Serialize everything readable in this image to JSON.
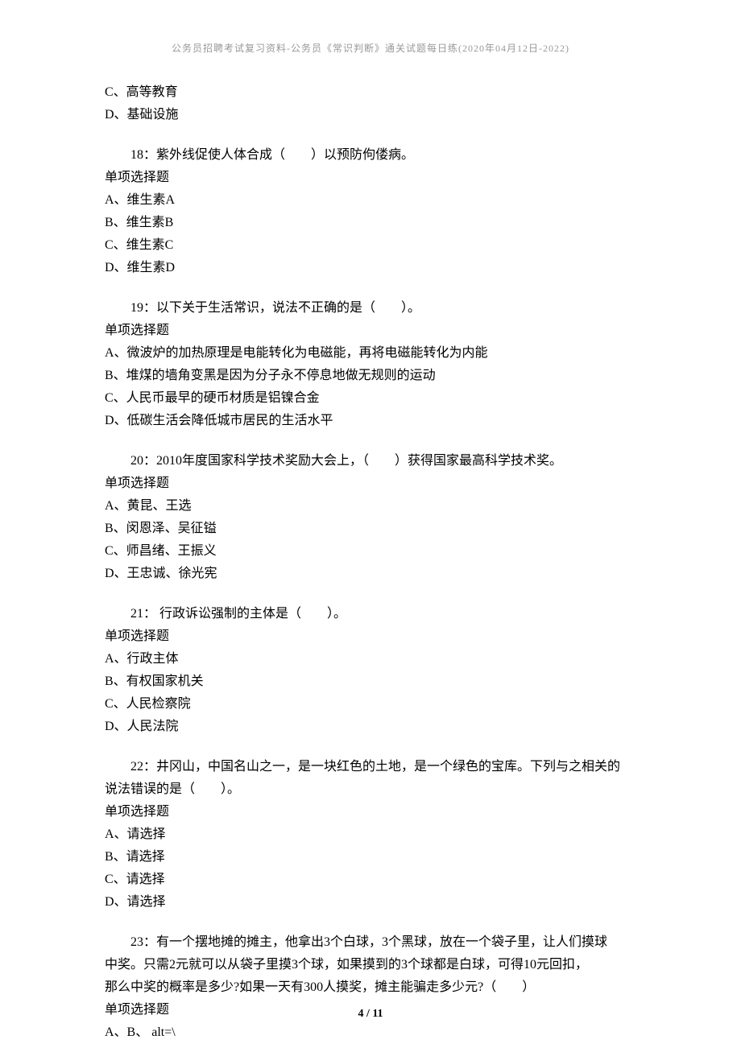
{
  "header": "公务员招聘考试复习资料-公务员《常识判断》通关试题每日练(2020年04月12日-2022)",
  "prev_options": {
    "c": "C、高等教育",
    "d": "D、基础设施"
  },
  "questions": [
    {
      "stem": "18：紫外线促使人体合成（　　）以预防佝偻病。",
      "type": "单项选择题",
      "options": [
        "A、维生素A",
        "B、维生素B",
        "C、维生素C",
        "D、维生素D"
      ]
    },
    {
      "stem": "19：以下关于生活常识，说法不正确的是（　　）。",
      "type": "单项选择题",
      "options": [
        "A、微波炉的加热原理是电能转化为电磁能，再将电磁能转化为内能",
        "B、堆煤的墙角变黑是因为分子永不停息地做无规则的运动",
        "C、人民币最早的硬币材质是铝镍合金",
        "D、低碳生活会降低城市居民的生活水平"
      ]
    },
    {
      "stem": "20：2010年度国家科学技术奖励大会上，（　　）获得国家最高科学技术奖。",
      "type": "单项选择题",
      "options": [
        "A、黄昆、王选",
        "B、闵恩泽、吴征镒",
        "C、师昌绪、王振义",
        "D、王忠诚、徐光宪"
      ]
    },
    {
      "stem": "21： 行政诉讼强制的主体是（　　）。",
      "type": "单项选择题",
      "options": [
        "A、行政主体",
        "B、有权国家机关",
        "C、人民检察院",
        "D、人民法院"
      ]
    },
    {
      "stem": "22：井冈山，中国名山之一，是一块红色的土地，是一个绿色的宝库。下列与之相关的说法错误的是（　　）。",
      "stem_line1": "22：井冈山，中国名山之一，是一块红色的土地，是一个绿色的宝库。下列与之相关的",
      "stem_line2": "说法错误的是（　　）。",
      "type": "单项选择题",
      "options": [
        "A、请选择",
        "B、请选择",
        "C、请选择",
        "D、请选择"
      ]
    },
    {
      "stem_line1": "23：有一个摆地摊的摊主，他拿出3个白球，3个黑球，放在一个袋子里，让人们摸球",
      "stem_line2": "中奖。只需2元就可以从袋子里摸3个球，如果摸到的3个球都是白球，可得10元回扣，",
      "stem_line3": "那么中奖的概率是多少?如果一天有300人摸奖，摊主能骗走多少元?（　　）",
      "type": "单项选择题",
      "options": [
        "A、B、 alt=\\"
      ]
    }
  ],
  "page_number": "4 / 11"
}
